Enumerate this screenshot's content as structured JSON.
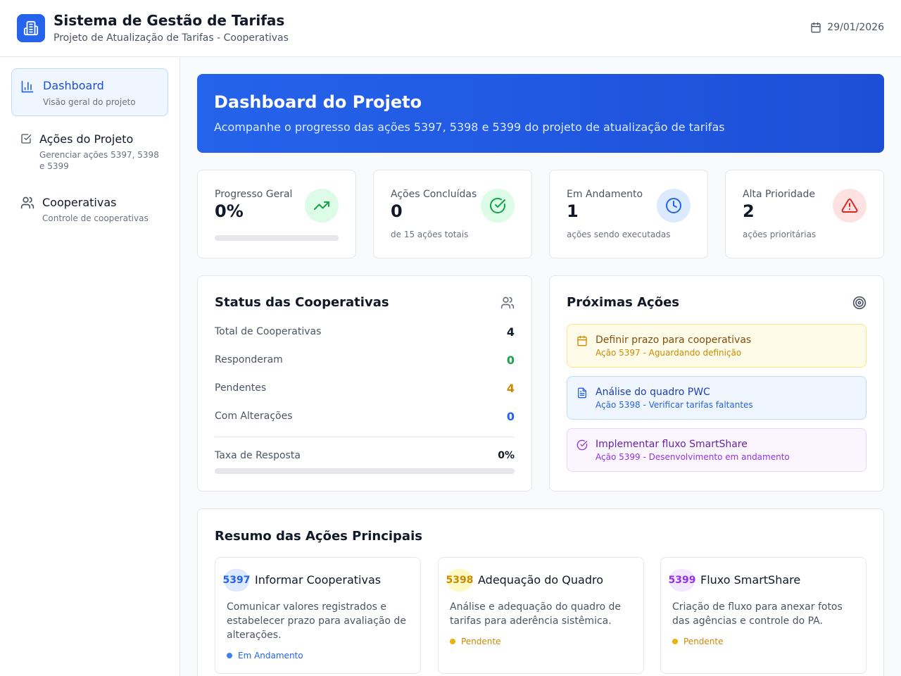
{
  "header": {
    "title": "Sistema de Gestão de Tarifas",
    "subtitle": "Projeto de Atualização de Tarifas - Cooperativas",
    "date": "29/01/2026",
    "logo_icon": "building-icon",
    "date_icon": "calendar-icon"
  },
  "sidebar": {
    "items": [
      {
        "label": "Dashboard",
        "description": "Visão geral do projeto",
        "icon": "bar-chart-icon",
        "active": true
      },
      {
        "label": "Ações do Projeto",
        "description": "Gerenciar ações 5397, 5398 e 5399",
        "icon": "check-square-icon",
        "active": false
      },
      {
        "label": "Cooperativas",
        "description": "Controle de cooperativas",
        "icon": "users-icon",
        "active": false
      }
    ]
  },
  "hero": {
    "title": "Dashboard do Projeto",
    "subtitle": "Acompanhe o progresso das ações 5397, 5398 e 5399 do projeto de atualização de tarifas"
  },
  "stats": [
    {
      "label": "Progresso Geral",
      "value": "0%",
      "progress": 0,
      "icon": "trending-up-icon",
      "color": "#16a34a"
    },
    {
      "label": "Ações Concluídas",
      "value": "0",
      "note": "de 15 ações totais",
      "icon": "check-circle-icon",
      "color": "#16a34a"
    },
    {
      "label": "Em Andamento",
      "value": "1",
      "note": "ações sendo executadas",
      "icon": "clock-icon",
      "color": "#2563eb"
    },
    {
      "label": "Alta Prioridade",
      "value": "2",
      "note": "ações prioritárias",
      "icon": "alert-triangle-icon",
      "color": "#dc2626"
    }
  ],
  "coop_status": {
    "title": "Status das Cooperativas",
    "icon": "users-icon",
    "rows": [
      {
        "label": "Total de Cooperativas",
        "value": "4",
        "color": "#111827"
      },
      {
        "label": "Responderam",
        "value": "0",
        "color": "#16a34a"
      },
      {
        "label": "Pendentes",
        "value": "4",
        "color": "#ca8a04"
      },
      {
        "label": "Com Alterações",
        "value": "0",
        "color": "#2563eb"
      }
    ],
    "rate_label": "Taxa de Resposta",
    "rate_value": "0%",
    "rate_progress": 0
  },
  "next_actions": {
    "title": "Próximas Ações",
    "icon": "target-icon",
    "items": [
      {
        "title": "Definir prazo para cooperativas",
        "subtitle": "Ação 5397 - Aguardando definição",
        "icon": "calendar-icon"
      },
      {
        "title": "Análise do quadro PWC",
        "subtitle": "Ação 5398 - Verificar tarifas faltantes",
        "icon": "file-text-icon"
      },
      {
        "title": "Implementar fluxo SmartShare",
        "subtitle": "Ação 5399 - Desenvolvimento em andamento",
        "icon": "check-circle-icon"
      }
    ]
  },
  "summary": {
    "title": "Resumo das Ações Principais",
    "cards": [
      {
        "code": "5397",
        "title": "Informar Cooperativas",
        "description": "Comunicar valores registrados e estabelecer prazo para avaliação de alterações.",
        "status": "Em Andamento",
        "color": "#2563eb"
      },
      {
        "code": "5398",
        "title": "Adequação do Quadro",
        "description": "Análise e adequação do quadro de tarifas para aderência sistêmica.",
        "status": "Pendente",
        "color": "#ca8a04"
      },
      {
        "code": "5399",
        "title": "Fluxo SmartShare",
        "description": "Criação de fluxo para anexar fotos das agências e controle do PA.",
        "status": "Pendente",
        "color": "#9333ea"
      }
    ]
  }
}
